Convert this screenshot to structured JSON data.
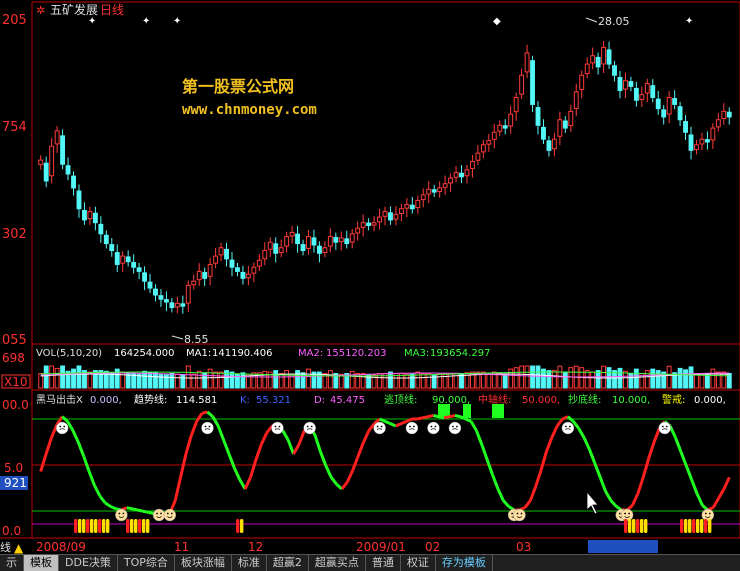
{
  "header": {
    "title": "五矿发展",
    "period": "日线",
    "watermark_name": "第一股票公式网",
    "watermark_url": "www.chnmoney.com"
  },
  "price_panel": {
    "y_ticks": [
      "205",
      "754",
      "302",
      "055"
    ],
    "high_label": "28.05",
    "low_label": "8.55",
    "high_value": 28.05,
    "low_value": 8.55,
    "colors": {
      "up": "#ff3b3b",
      "down": "#54f7f7",
      "axis": "#c00000",
      "text_red": "#ff2020"
    }
  },
  "volume_panel": {
    "label": "VOL(5,10,20)",
    "value": "164254.000",
    "ma1_label": "MA1:",
    "ma1_value": "141190.406",
    "ma2_label": "MA2:",
    "ma2_value": "155120.203",
    "ma3_label": "MA3:",
    "ma3_value": "193654.297",
    "y_ticks": [
      "698",
      "X10"
    ]
  },
  "indicator_panel": {
    "name": "黑马出击X",
    "name_value": "0.000,",
    "trend_label": "趋势线:",
    "trend_value": "114.581",
    "k_label": "K:",
    "k_value": "55.321",
    "d_label": "D:",
    "d_value": "45.475",
    "escape_label": "逃顶线:",
    "escape_value": "90.000,",
    "mid_label": "中轴线:",
    "mid_value": "50.000,",
    "bottom_label": "抄底线:",
    "bottom_value": "10.000,",
    "alert_label": "警戒:",
    "alert_value": "0.000,",
    "y_ticks": [
      "00.0",
      "5.0",
      "921",
      "0.0"
    ],
    "colors": {
      "escape": "#00c000",
      "mid": "#c00000",
      "bottom": "#00c000",
      "alert": "#c000c0"
    }
  },
  "time_axis": {
    "labels": [
      "2008/09",
      "11",
      "12",
      "2009/01",
      "02",
      "03"
    ],
    "left_char": "线"
  },
  "bottom_tabs": [
    {
      "label": "示"
    },
    {
      "label": "模板"
    },
    {
      "label": "DDE决策"
    },
    {
      "label": "TOP综合"
    },
    {
      "label": "板块涨幅"
    },
    {
      "label": "标准"
    },
    {
      "label": "超赢2"
    },
    {
      "label": "超赢买点"
    },
    {
      "label": "普通"
    },
    {
      "label": "权证"
    },
    {
      "label": "存为模板"
    }
  ],
  "chart_data": [
    {
      "type": "candlestick",
      "title": "五矿发展 日线",
      "ylim": [
        7.0,
        30.0
      ],
      "x": "trading days (2008/09 – 2009/04)",
      "close": [
        19.5,
        18.0,
        20.5,
        21.6,
        19.2,
        18.5,
        17.5,
        16.0,
        15.2,
        15.8,
        15.0,
        14.2,
        13.5,
        13.0,
        12.0,
        12.6,
        12.2,
        11.8,
        11.5,
        10.8,
        10.3,
        9.8,
        9.5,
        9.3,
        8.9,
        9.2,
        9.0,
        10.5,
        10.8,
        11.5,
        11.0,
        12.0,
        12.6,
        13.2,
        12.4,
        11.8,
        11.5,
        11.0,
        11.3,
        11.8,
        12.3,
        13.0,
        13.6,
        12.8,
        13.2,
        14.0,
        14.3,
        13.5,
        13.0,
        14.0,
        13.4,
        12.8,
        13.2,
        14.0,
        13.6,
        13.9,
        13.5,
        14.2,
        14.6,
        15.0,
        14.8,
        15.0,
        15.4,
        15.8,
        15.2,
        15.6,
        16.0,
        16.3,
        16.0,
        16.6,
        17.0,
        17.4,
        17.2,
        17.5,
        17.8,
        18.2,
        18.6,
        18.3,
        18.8,
        19.4,
        20.0,
        20.6,
        20.9,
        21.5,
        22.0,
        21.8,
        22.8,
        24.0,
        25.6,
        27.2,
        23.5,
        22.0,
        21.0,
        20.2,
        21.0,
        22.4,
        21.8,
        23.0,
        24.4,
        25.6,
        26.4,
        27.0,
        26.2,
        27.6,
        26.4,
        25.6,
        24.5,
        25.2,
        24.8,
        23.8,
        24.2,
        25.0,
        24.0,
        23.2,
        22.6,
        24.0,
        23.5,
        22.4,
        21.5,
        20.2,
        20.6,
        21.0,
        20.8,
        21.8,
        22.4,
        23.0,
        22.6
      ]
    },
    {
      "type": "bar",
      "title": "VOL(5,10,20)",
      "series": [
        {
          "name": "MA1",
          "values": [
            141190.406
          ]
        },
        {
          "name": "MA2",
          "values": [
            155120.203
          ]
        },
        {
          "name": "MA3",
          "values": [
            193654.297
          ]
        }
      ]
    },
    {
      "type": "line",
      "title": "黑马出击X",
      "ylim": [
        0,
        100
      ],
      "reference_lines": {
        "逃顶线": 90,
        "中轴线": 50,
        "抄底线": 10,
        "警戒": 0
      },
      "series": [
        {
          "name": "趋势线",
          "values": [
            45,
            60,
            74,
            85,
            92,
            88,
            80,
            70,
            58,
            45,
            33,
            24,
            18,
            15,
            13,
            12,
            14,
            13,
            12,
            11,
            10,
            9,
            8,
            9,
            9,
            20,
            40,
            60,
            76,
            88,
            95,
            96,
            92,
            84,
            72,
            60,
            48,
            38,
            30,
            40,
            55,
            68,
            78,
            84,
            86,
            80,
            72,
            60,
            68,
            80,
            84,
            76,
            62,
            50,
            40,
            34,
            30,
            36,
            46,
            58,
            70,
            80,
            86,
            90,
            88,
            86,
            84,
            86,
            88,
            90,
            90,
            91,
            92,
            93,
            92,
            91,
            92,
            93,
            92,
            90,
            88,
            80,
            68,
            55,
            42,
            30,
            20,
            15,
            12,
            12,
            14,
            20,
            32,
            46,
            62,
            74,
            84,
            90,
            92,
            88,
            82,
            74,
            64,
            52,
            40,
            28,
            20,
            15,
            12,
            12,
            16,
            26,
            40,
            56,
            70,
            82,
            88,
            84,
            74,
            62,
            50,
            38,
            26,
            16,
            12,
            14,
            22,
            30,
            40
          ]
        }
      ]
    }
  ]
}
